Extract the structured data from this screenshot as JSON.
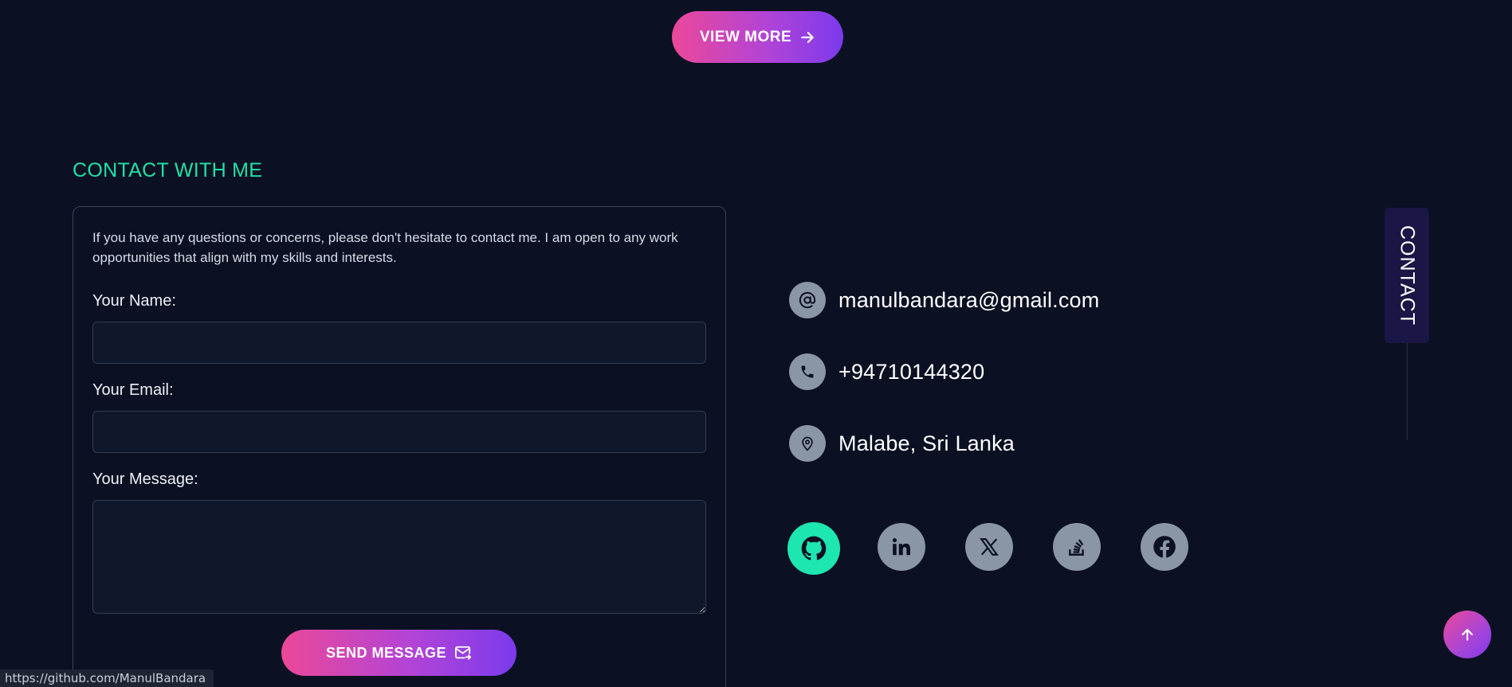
{
  "view_more": {
    "label": "VIEW MORE"
  },
  "contact": {
    "title": "CONTACT WITH ME",
    "intro": "If you have any questions or concerns, please don't hesitate to contact me. I am open to any work opportunities that align with my skills and interests.",
    "form": {
      "name_label": "Your Name:",
      "name_value": "",
      "email_label": "Your Email:",
      "email_value": "",
      "message_label": "Your Message:",
      "message_value": "",
      "send_label": "SEND MESSAGE"
    },
    "info": {
      "email": "manulbandara@gmail.com",
      "phone": "+94710144320",
      "location": "Malabe, Sri Lanka"
    },
    "socials": [
      {
        "name": "GitHub",
        "icon": "github-icon",
        "active": true
      },
      {
        "name": "LinkedIn",
        "icon": "linkedin-icon",
        "active": false
      },
      {
        "name": "X",
        "icon": "x-icon",
        "active": false
      },
      {
        "name": "Stack Overflow",
        "icon": "stackoverflow-icon",
        "active": false
      },
      {
        "name": "Facebook",
        "icon": "facebook-icon",
        "active": false
      }
    ]
  },
  "side_tab": {
    "label": "CONTACT"
  },
  "status_bar": {
    "url": "https://github.com/ManulBandara"
  },
  "colors": {
    "background": "#0b1123",
    "accent_green": "#22e0a7",
    "gradient_start": "#ec4899",
    "gradient_end": "#7c3aed",
    "icon_gray": "#8a95a5"
  }
}
